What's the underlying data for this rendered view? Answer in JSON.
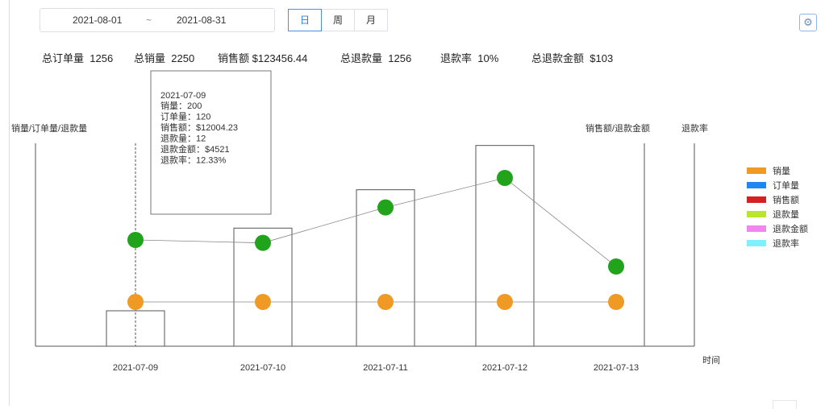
{
  "filter": {
    "start_date": "2021-08-01",
    "separator": "~",
    "end_date": "2021-08-31",
    "tabs": [
      "日",
      "周",
      "月"
    ],
    "active_tab": "日"
  },
  "summary": {
    "total_orders_label": "总订单量",
    "total_orders_value": "1256",
    "total_sales_label": "总销量",
    "total_sales_value": "2250",
    "sales_amount_label": "销售额",
    "sales_amount_value": "$123456.44",
    "total_refunds_label": "总退款量",
    "total_refunds_value": "1256",
    "refund_rate_label": "退款率",
    "refund_rate_value": "10%",
    "total_refund_amount_label": "总退款金额",
    "total_refund_amount_value": "$103"
  },
  "tooltip": {
    "title": "2021-07-09",
    "lines": [
      "销量：200",
      "订单量：120",
      "销售额：$12004.23",
      "退款量：12",
      "退款金额：$4521",
      "退款率：12.33%"
    ]
  },
  "chart_data": {
    "type": "bar",
    "categories": [
      "2021-07-09",
      "2021-07-10",
      "2021-07-11",
      "2021-07-12",
      "2021-07-13"
    ],
    "xlabel": "时间",
    "ylabel_left": "销量/订单量/退款量",
    "ylabel_right_1": "销售额/退款金额",
    "ylabel_right_2": "退款率",
    "bars": [
      12,
      40,
      53,
      68,
      0
    ],
    "green_points": [
      36,
      35,
      47,
      57,
      27
    ],
    "orange_points": [
      15,
      15,
      15,
      15,
      15
    ],
    "colors": {
      "bar_stroke": "#555555",
      "line": "#888888",
      "green": "#22a31c",
      "orange": "#f09a26",
      "axis": "#555555"
    },
    "legend": [
      {
        "name": "销量",
        "color": "#f09a26"
      },
      {
        "name": "订单量",
        "color": "#1e88f0"
      },
      {
        "name": "销售额",
        "color": "#d42020"
      },
      {
        "name": "退款量",
        "color": "#b9e52c"
      },
      {
        "name": "退款金额",
        "color": "#f086ee"
      },
      {
        "name": "退款率",
        "color": "#7ff0ff"
      }
    ],
    "legend_position": "right",
    "grid": false
  }
}
